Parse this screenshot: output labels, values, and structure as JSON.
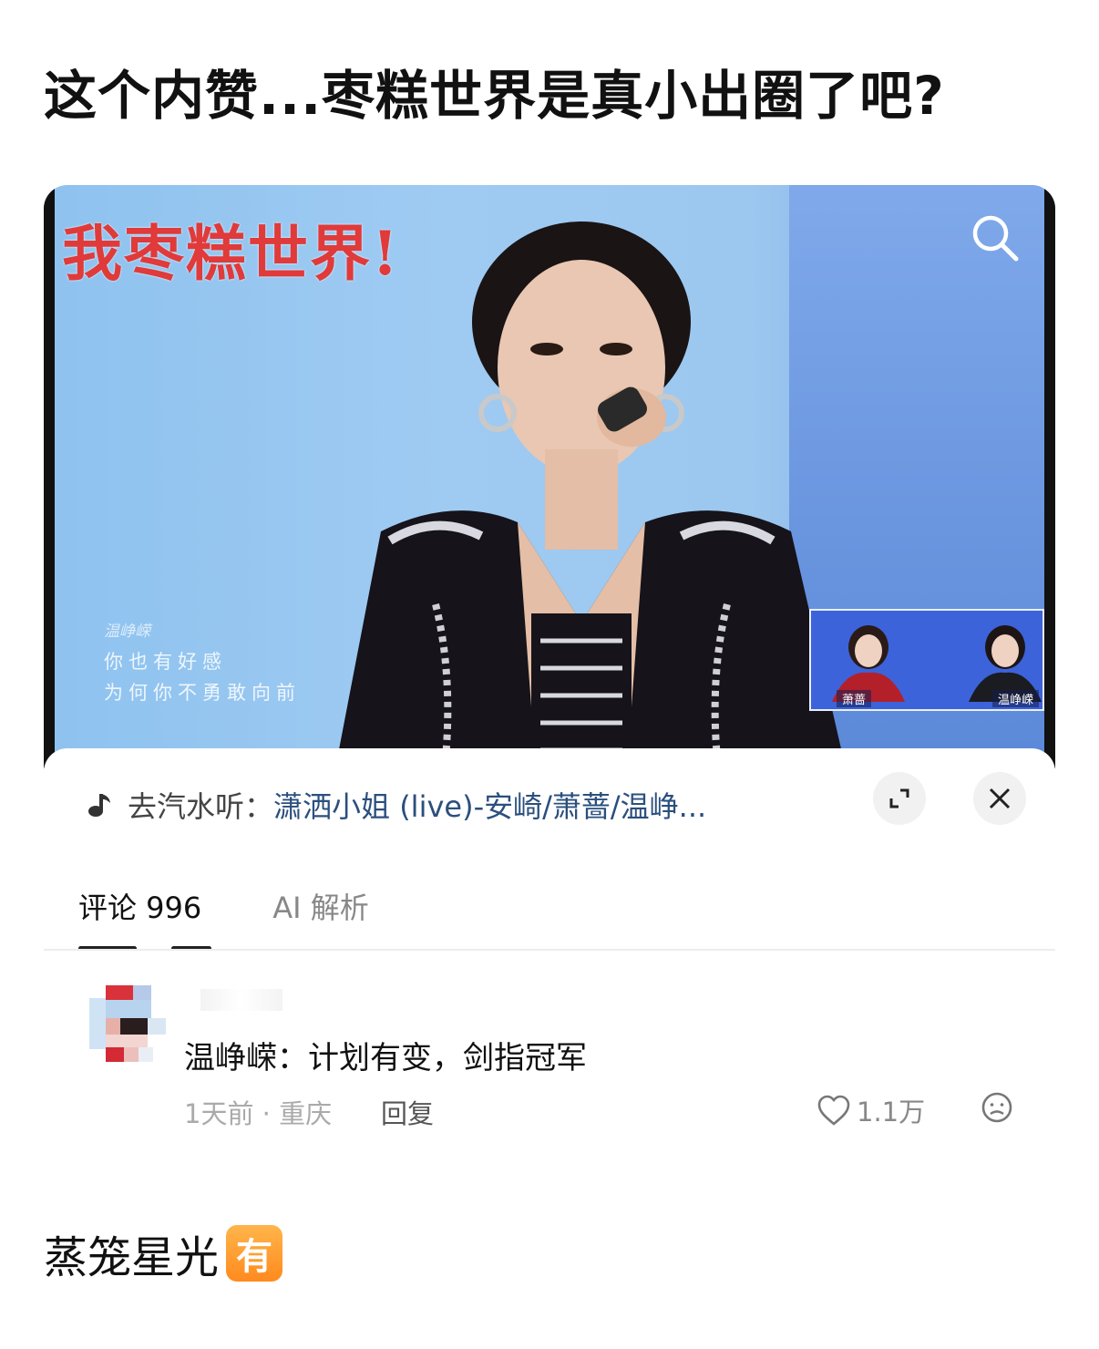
{
  "post": {
    "title": "这个内赞...枣糕世界是真小出圈了吧?"
  },
  "video": {
    "overlay_caption": "我枣糕世界!",
    "lyrics": {
      "singer": "温峥嵘",
      "line1": "你也有好感",
      "line2": "为何你不勇敢向前"
    },
    "pip": {
      "left_name": "萧蔷",
      "right_name": "温峥嵘"
    }
  },
  "music_bar": {
    "prefix": "去汽水听：",
    "song": "潇洒小姐 (live)-安崎/萧蔷/温峥..."
  },
  "tabs": {
    "comments": "评论 996",
    "ai": "AI 解析"
  },
  "comment": {
    "text": "温峥嵘：计划有变，剑指冠军",
    "time_location": "1天前 · 重庆",
    "reply": "回复",
    "likes": "1.1万"
  },
  "footer": {
    "author": "蒸笼星光",
    "badge": "有"
  },
  "colors": {
    "song_link": "#2b4f7e",
    "caption_red": "#e03a3a",
    "badge_orange": "#ff9a2e"
  }
}
